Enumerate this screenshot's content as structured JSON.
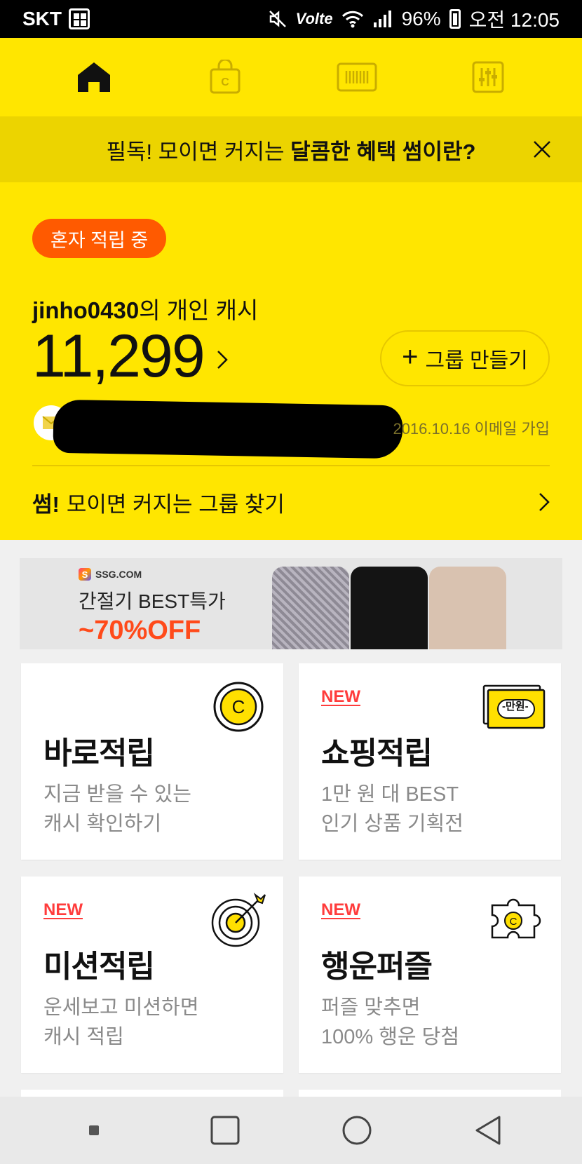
{
  "status": {
    "carrier": "SKT",
    "volte": "Volte",
    "battery": "96%",
    "time": "오전 12:05"
  },
  "nav": {
    "tabs": [
      "home-icon",
      "shopping-bag-icon",
      "barcode-icon",
      "settings-sliders-icon"
    ]
  },
  "notice": {
    "text_prefix": "필독! 모이면 커지는 ",
    "text_bold": "달콤한 혜택 썸이란?"
  },
  "profile": {
    "badge": "혼자 적립 중",
    "user_id": "jinho0430",
    "user_suffix": "의 개인 캐시",
    "cash": "11,299",
    "group_button": "그룹 만들기",
    "join_info": "2016.10.16 이메일 가입",
    "group_find_bold": "썸!",
    "group_find_text": "모이면 커지는 그룹 찾기"
  },
  "banner": {
    "brand": "SSG.COM",
    "title": "간절기 BEST특가",
    "discount": "~70%OFF"
  },
  "cards": [
    {
      "new": "",
      "title": "바로적립",
      "desc1": "지금 받을 수 있는",
      "desc2": "캐시 확인하기",
      "icon": "coin-icon"
    },
    {
      "new": "NEW",
      "title": "쇼핑적립",
      "desc1": "1만 원 대 BEST",
      "desc2": "인기 상품 기획전",
      "icon": "voucher-icon",
      "voucher_label": "-만원-"
    },
    {
      "new": "NEW",
      "title": "미션적립",
      "desc1": "운세보고 미션하면",
      "desc2": "캐시 적립",
      "icon": "target-icon"
    },
    {
      "new": "NEW",
      "title": "행운퍼즐",
      "desc1": "퍼즐 맞추면",
      "desc2": "100% 행운 당첨",
      "icon": "puzzle-icon"
    }
  ],
  "colors": {
    "brand_yellow": "#ffe600",
    "notice_bg": "#ecd400",
    "badge_orange": "#ff5a00",
    "new_red": "#ff3c3c"
  }
}
